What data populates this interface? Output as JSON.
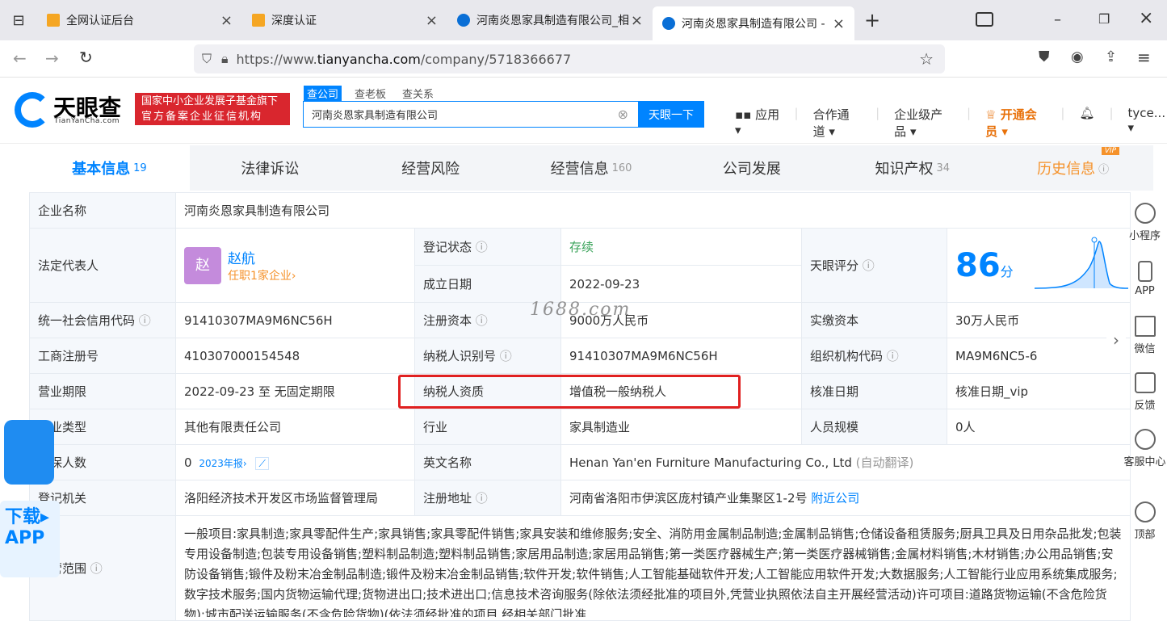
{
  "browser": {
    "tabs": [
      {
        "title": "全网认证后台",
        "active": false
      },
      {
        "title": "深度认证",
        "active": false
      },
      {
        "title": "河南炎恩家具制造有限公司_相",
        "active": false
      },
      {
        "title": "河南炎恩家具制造有限公司 - ",
        "active": true
      }
    ],
    "url_prefix": "https://www.",
    "url_host": "tianyancha.com",
    "url_path": "/company/5718366677"
  },
  "header": {
    "logo_text": "天眼查",
    "logo_sub": "TianYanCha.com",
    "badge_line1": "国家中小企业发展子基金旗下",
    "badge_line2": "官方备案企业征信机构",
    "search_tabs": [
      "查公司",
      "查老板",
      "查关系"
    ],
    "search_value": "河南炎恩家具制造有限公司",
    "search_button": "天眼一下",
    "nav": [
      "应用",
      "合作通道",
      "企业级产品",
      "开通会员",
      "tyce..."
    ]
  },
  "tabs": [
    {
      "label": "基本信息",
      "count": "19"
    },
    {
      "label": "法律诉讼",
      "count": ""
    },
    {
      "label": "经营风险",
      "count": ""
    },
    {
      "label": "经营信息",
      "count": "160"
    },
    {
      "label": "公司发展",
      "count": ""
    },
    {
      "label": "知识产权",
      "count": "34"
    },
    {
      "label": "历史信息",
      "count": ""
    }
  ],
  "vip_tag": "VIP",
  "info": {
    "company_name_label": "企业名称",
    "company_name": "河南炎恩家具制造有限公司",
    "legal_rep_label": "法定代表人",
    "legal_rep_avatar": "赵",
    "legal_rep_name": "赵航",
    "legal_rep_sub": "任职1家企业›",
    "reg_status_label": "登记状态",
    "reg_status": "存续",
    "found_date_label": "成立日期",
    "found_date": "2022-09-23",
    "score_label": "天眼评分",
    "score": "86",
    "score_unit": "分",
    "credit_code_label": "统一社会信用代码",
    "credit_code": "91410307MA9M6NC56H",
    "reg_capital_label": "注册资本",
    "reg_capital": "9000万人民币",
    "paid_capital_label": "实缴资本",
    "paid_capital": "30万人民币",
    "biz_reg_no_label": "工商注册号",
    "biz_reg_no": "410307000154548",
    "taxpayer_id_label": "纳税人识别号",
    "taxpayer_id": "91410307MA9M6NC56H",
    "org_code_label": "组织机构代码",
    "org_code": "MA9M6NC5-6",
    "term_label": "营业期限",
    "term": "2022-09-23 至 无固定期限",
    "tax_qual_label": "纳税人资质",
    "tax_qual": "增值税一般纳税人",
    "approve_date_label": "核准日期",
    "approve_date": "核准日期_vip",
    "type_label": "企业类型",
    "type": "其他有限责任公司",
    "industry_label": "行业",
    "industry": "家具制造业",
    "staff_label": "人员规模",
    "staff": "0人",
    "insured_label": "参保人数",
    "insured": "0",
    "insured_report": "2023年报›",
    "english_label": "英文名称",
    "english": "Henan Yan'en Furniture Manufacturing Co., Ltd",
    "english_note": "(自动翻译)",
    "authority_label": "登记机关",
    "authority": "洛阳经济技术开发区市场监督管理局",
    "address_label": "注册地址",
    "address": "河南省洛阳市伊滨区庞村镇产业集聚区1-2号",
    "address_link": "附近公司",
    "scope_label": "经营范围",
    "scope": "一般项目:家具制造;家具零配件生产;家具销售;家具零配件销售;家具安装和维修服务;安全、消防用金属制品制造;金属制品销售;仓储设备租赁服务;厨具卫具及日用杂品批发;包装专用设备制造;包装专用设备销售;塑料制品制造;塑料制品销售;家居用品制造;家居用品销售;第一类医疗器械生产;第一类医疗器械销售;金属材料销售;木材销售;办公用品销售;安防设备销售;锻件及粉末冶金制品制造;锻件及粉末冶金制品销售;软件开发;软件销售;人工智能基础软件开发;人工智能应用软件开发;大数据服务;人工智能行业应用系统集成服务;数字技术服务;国内货物运输代理;货物进出口;技术进出口;信息技术咨询服务(除依法须经批准的项目外,凭营业执照依法自主开展经营活动)许可项目:道路货物运输(不含危险货物);城市配送运输服务(不含危险货物)(依法须经批准的项目,经相关部门批准"
  },
  "watermark": "1688.com",
  "sidebar": [
    "小程序",
    "APP",
    "微信",
    "反馈",
    "客服中心",
    "顶部"
  ],
  "download": {
    "line1": "下载▸",
    "line2": "APP"
  }
}
